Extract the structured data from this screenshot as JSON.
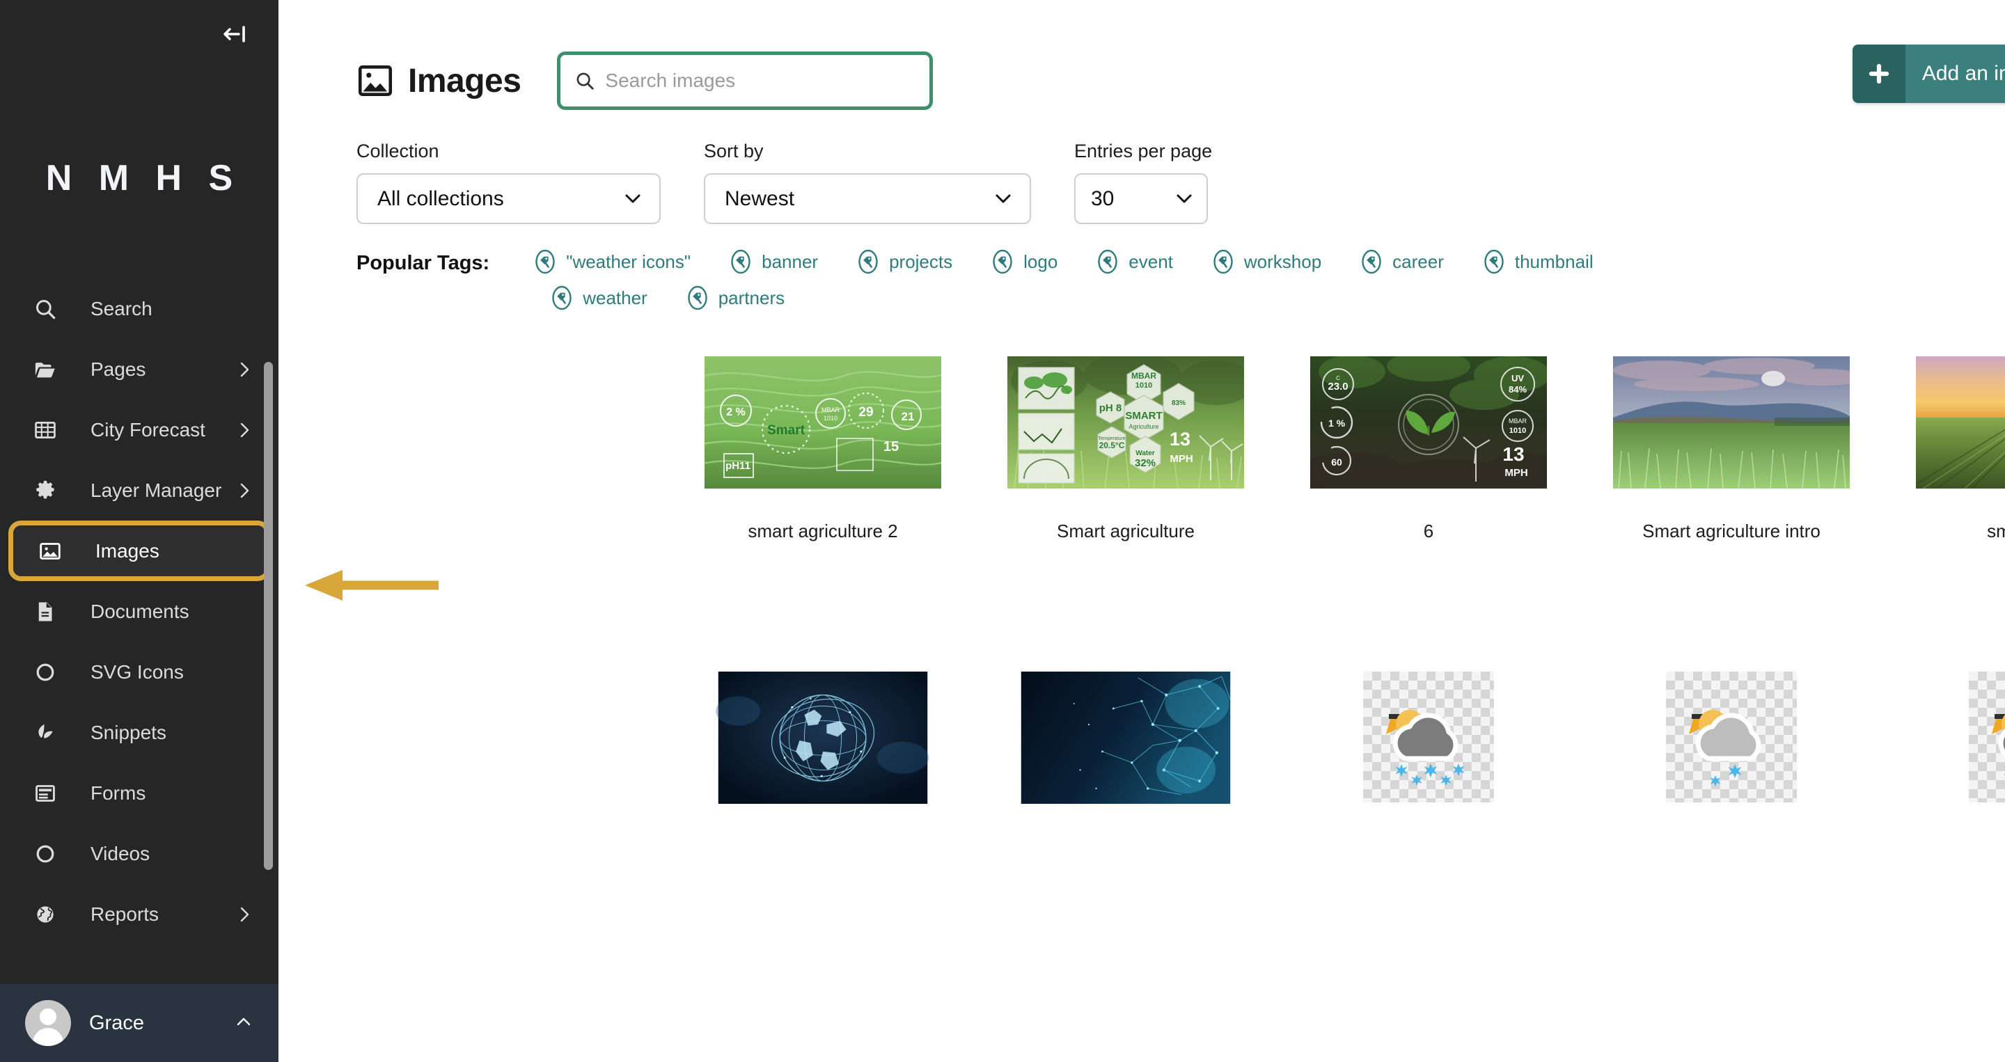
{
  "sidebar": {
    "collapse_icon": "collapse-left-icon",
    "brand": "N M H S",
    "items": [
      {
        "label": "Search",
        "icon": "search-icon",
        "chevron": "",
        "active": false
      },
      {
        "label": "Pages",
        "icon": "folder-open-icon",
        "chevron": "›",
        "active": false
      },
      {
        "label": "City Forecast",
        "icon": "table-icon",
        "chevron": "›",
        "active": false
      },
      {
        "label": "Layer Manager",
        "icon": "gear-icon",
        "chevron": "›",
        "active": false
      },
      {
        "label": "Images",
        "icon": "image-icon",
        "chevron": "",
        "active": true
      },
      {
        "label": "Documents",
        "icon": "document-icon",
        "chevron": "",
        "active": false
      },
      {
        "label": "SVG Icons",
        "icon": "circle-icon",
        "chevron": "",
        "active": false
      },
      {
        "label": "Snippets",
        "icon": "leaf-icon",
        "chevron": "",
        "active": false
      },
      {
        "label": "Forms",
        "icon": "form-icon",
        "chevron": "",
        "active": false
      },
      {
        "label": "Videos",
        "icon": "circle-icon",
        "chevron": "",
        "active": false
      },
      {
        "label": "Reports",
        "icon": "globe-icon",
        "chevron": "›",
        "active": false
      }
    ],
    "user": {
      "name": "Grace",
      "chevron": "⌃",
      "avatar": "avatar-icon"
    }
  },
  "header": {
    "icon": "image-icon",
    "title": "Images",
    "search": {
      "placeholder": "Search images",
      "value": "",
      "icon": "search-icon"
    },
    "add_button": {
      "label": "Add an image",
      "icon": "plus-icon"
    }
  },
  "filters": {
    "collection": {
      "label": "Collection",
      "value": "All collections"
    },
    "sort_by": {
      "label": "Sort by",
      "value": "Newest"
    },
    "entries_per_page": {
      "label": "Entries per page",
      "value": "30"
    }
  },
  "tags": {
    "label": "Popular Tags:",
    "items": [
      "\"weather icons\"",
      "banner",
      "projects",
      "logo",
      "event",
      "workshop",
      "career",
      "thumbnail",
      "weather",
      "partners"
    ]
  },
  "grid": {
    "row1": [
      {
        "caption": "smart agriculture 2",
        "kind": "smart-field"
      },
      {
        "caption": "Smart agriculture",
        "kind": "smart-hex"
      },
      {
        "caption": "6",
        "kind": "smart-seedling"
      },
      {
        "caption": "Smart agriculture intro",
        "kind": "cornfield"
      },
      {
        "caption": "smart_agric",
        "kind": "sunset-field"
      }
    ],
    "row2": [
      {
        "caption": "",
        "kind": "globe-network"
      },
      {
        "caption": "",
        "kind": "blue-network"
      },
      {
        "caption": "",
        "kind": "cloud-snow-heavy"
      },
      {
        "caption": "",
        "kind": "cloud-snow-light"
      },
      {
        "caption": "",
        "kind": "cloud-sleet"
      }
    ]
  },
  "annotation": {
    "arrow": "left-arrow-annotation",
    "color": "#d9a63a"
  },
  "colors": {
    "sidebar_bg": "#262626",
    "sidebar_user_bg": "#2a3340",
    "accent_teal": "#3c807d",
    "accent_teal_dark": "#2a6260",
    "tag_teal": "#2f7b7b",
    "focus_green": "#3f8f6f",
    "highlight_gold": "#d9a63a"
  }
}
